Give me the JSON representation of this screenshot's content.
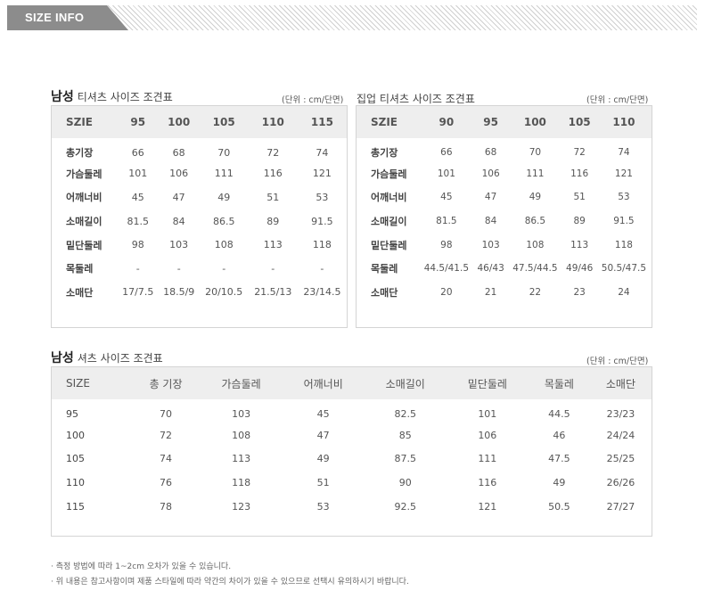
{
  "banner": {
    "label": "SIZE INFO"
  },
  "tshirt": {
    "title_bold": "남성",
    "title_rest": "티셔츠 사이즈 조견표",
    "unit": "(단위 : cm/단면)",
    "headers": [
      "SZIE",
      "95",
      "100",
      "105",
      "110",
      "115"
    ],
    "rows": [
      [
        "총기장",
        "66",
        "68",
        "70",
        "72",
        "74"
      ],
      [
        "가슴둘레",
        "101",
        "106",
        "111",
        "116",
        "121"
      ],
      [
        "어깨너비",
        "45",
        "47",
        "49",
        "51",
        "53"
      ],
      [
        "소매길이",
        "81.5",
        "84",
        "86.5",
        "89",
        "91.5"
      ],
      [
        "밑단둘레",
        "98",
        "103",
        "108",
        "113",
        "118"
      ],
      [
        "목둘레",
        "-",
        "-",
        "-",
        "-",
        "-"
      ],
      [
        "소매단",
        "17/7.5",
        "18.5/9",
        "20/10.5",
        "21.5/13",
        "23/14.5"
      ]
    ]
  },
  "zipup": {
    "title": "집업 티셔츠 사이즈 조견표",
    "unit": "(단위 : cm/단면)",
    "headers": [
      "SZIE",
      "90",
      "95",
      "100",
      "105",
      "110"
    ],
    "rows": [
      [
        "총기장",
        "66",
        "68",
        "70",
        "72",
        "74"
      ],
      [
        "가슴둘레",
        "101",
        "106",
        "111",
        "116",
        "121"
      ],
      [
        "어깨너비",
        "45",
        "47",
        "49",
        "51",
        "53"
      ],
      [
        "소매길이",
        "81.5",
        "84",
        "86.5",
        "89",
        "91.5"
      ],
      [
        "밑단둘레",
        "98",
        "103",
        "108",
        "113",
        "118"
      ],
      [
        "목둘레",
        "44.5/41.5",
        "46/43",
        "47.5/44.5",
        "49/46",
        "50.5/47.5"
      ],
      [
        "소매단",
        "20",
        "21",
        "22",
        "23",
        "24"
      ]
    ]
  },
  "shirt": {
    "title_bold": "남성",
    "title_rest": "셔츠 사이즈 조견표",
    "unit": "(단위 : cm/단면)",
    "headers": [
      "SIZE",
      "총 기장",
      "가슴둘레",
      "어깨너비",
      "소매길이",
      "밑단둘레",
      "목둘레",
      "소매단"
    ],
    "rows": [
      [
        "95",
        "70",
        "103",
        "45",
        "82.5",
        "101",
        "44.5",
        "23/23"
      ],
      [
        "100",
        "72",
        "108",
        "47",
        "85",
        "106",
        "46",
        "24/24"
      ],
      [
        "105",
        "74",
        "113",
        "49",
        "87.5",
        "111",
        "47.5",
        "25/25"
      ],
      [
        "110",
        "76",
        "118",
        "51",
        "90",
        "116",
        "49",
        "26/26"
      ],
      [
        "115",
        "78",
        "123",
        "53",
        "92.5",
        "121",
        "50.5",
        "27/27"
      ]
    ]
  },
  "notes": [
    "· 측정 방법에 따라 1~2cm 오차가 있을 수 있습니다.",
    "· 위 내용은 참고사항이며 제품 스타일에 따라 약간의 차이가 있을 수 있으므로 선택시 유의하시기 바랍니다."
  ]
}
